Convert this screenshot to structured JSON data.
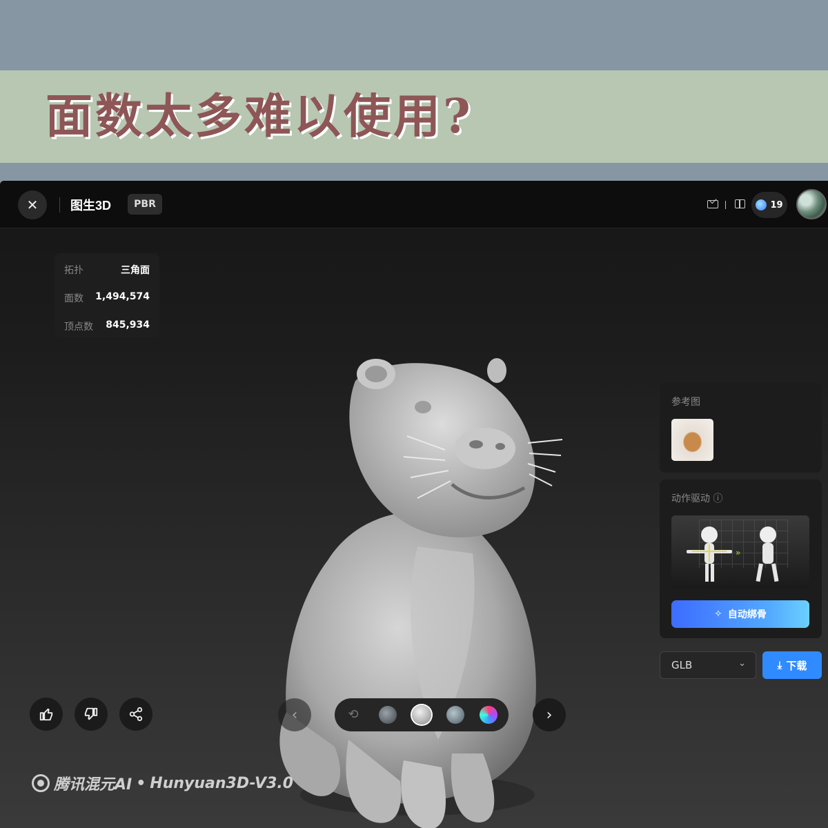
{
  "banner": {
    "title": "面数太多难以使用?"
  },
  "topbar": {
    "close_icon": "✕",
    "title": "图生3D",
    "badge": "PBR",
    "credits": "19",
    "icons": [
      "mail-icon",
      "gift-icon",
      "credit-icon",
      "avatar"
    ]
  },
  "stats": [
    {
      "label": "拓扑",
      "value": "三角面"
    },
    {
      "label": "面数",
      "value": "1,494,574"
    },
    {
      "label": "顶点数",
      "value": "845,934"
    }
  ],
  "reference": {
    "label": "参考图"
  },
  "motion": {
    "label": "动作驱动",
    "info_icon": "ⓘ",
    "bind_button": "自动绑骨"
  },
  "export": {
    "format": "GLB",
    "download": "下载"
  },
  "toolbar": {
    "icons": [
      "thumbs-up-icon",
      "thumbs-down-icon",
      "share-icon",
      "prev-icon",
      "next-icon"
    ],
    "materials": [
      "rotate-icon",
      "hdr-material",
      "gray-material",
      "environment-material",
      "rainbow-material"
    ]
  },
  "watermark": {
    "brand": "腾讯混元AI",
    "separator": "•",
    "product": "Hunyuan3D-V3.0"
  },
  "colors": {
    "banner_bg": "#b7c7b2",
    "title_text": "#8e5656",
    "accent": "#2f8bff"
  }
}
